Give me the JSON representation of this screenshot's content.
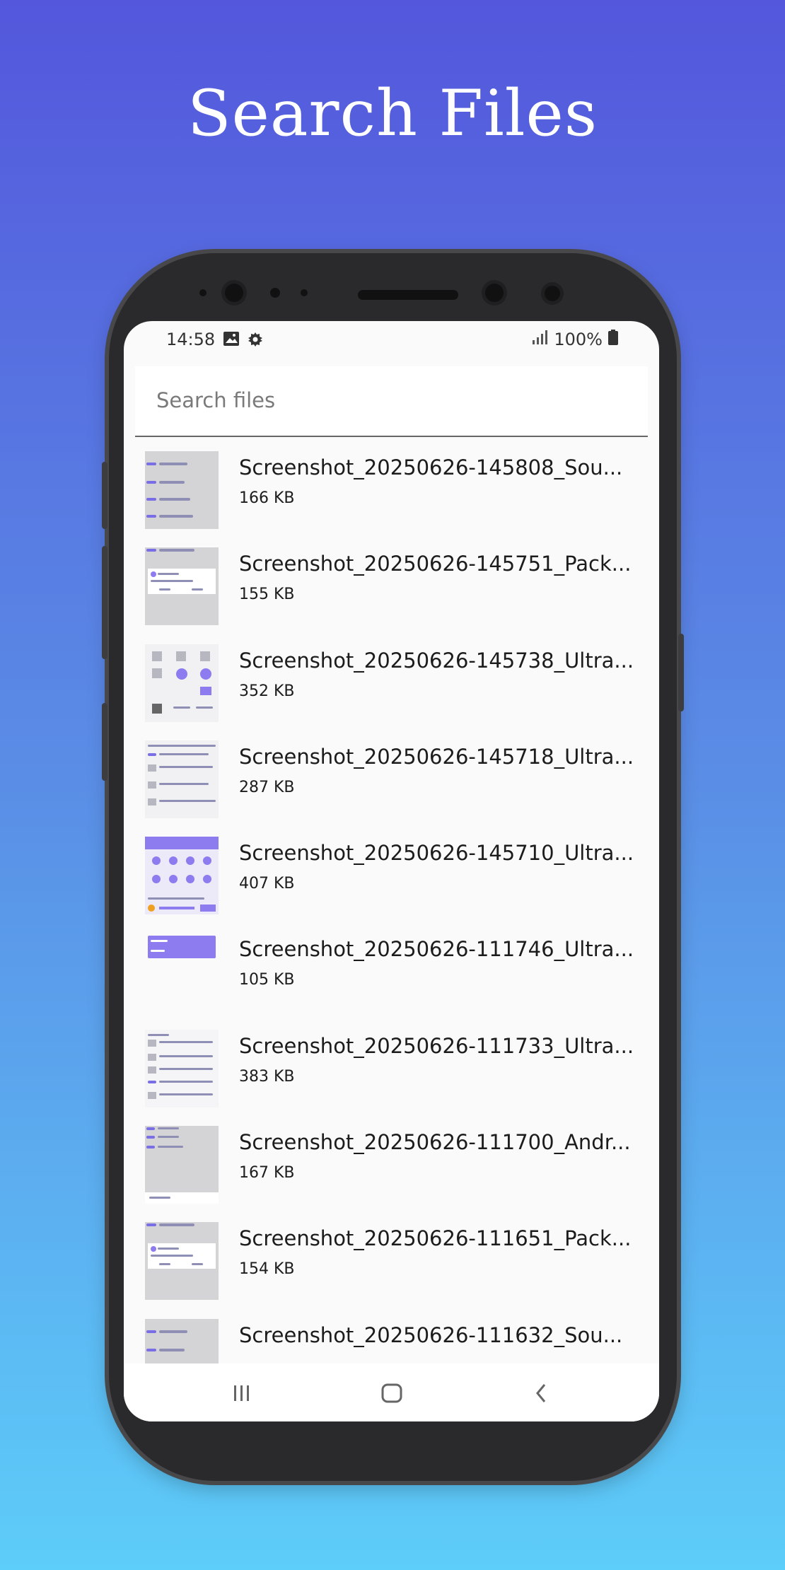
{
  "headline": "Search Files",
  "status_bar": {
    "time": "14:58",
    "left_icons": [
      "image-icon",
      "gear-icon"
    ],
    "battery_text": "100%",
    "right_icons": [
      "signal-icon",
      "battery-icon"
    ]
  },
  "search": {
    "placeholder": "Search files",
    "value": ""
  },
  "files": [
    {
      "name": "Screenshot_20250626-145808_Sou...",
      "size": "166 KB"
    },
    {
      "name": "Screenshot_20250626-145751_Pack...",
      "size": "155 KB"
    },
    {
      "name": "Screenshot_20250626-145738_Ultra...",
      "size": "352 KB"
    },
    {
      "name": "Screenshot_20250626-145718_Ultra...",
      "size": "287 KB"
    },
    {
      "name": "Screenshot_20250626-145710_Ultra...",
      "size": "407 KB"
    },
    {
      "name": "Screenshot_20250626-111746_Ultra...",
      "size": "105 KB"
    },
    {
      "name": "Screenshot_20250626-111733_Ultra...",
      "size": "383 KB"
    },
    {
      "name": "Screenshot_20250626-111700_Andr...",
      "size": "167 KB"
    },
    {
      "name": "Screenshot_20250626-111651_Pack...",
      "size": "154 KB"
    },
    {
      "name": "Screenshot_20250626-111632_Sou...",
      "size": ""
    }
  ],
  "nav_bar": {
    "icons": [
      "recent-apps-icon",
      "home-icon",
      "back-icon"
    ]
  },
  "colors": {
    "accent": "#7a6ee6",
    "background_top": "#5457dc",
    "background_bottom": "#5dcdf9"
  }
}
